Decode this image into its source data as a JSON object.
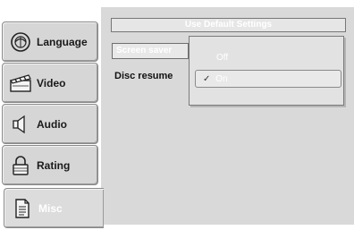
{
  "sidebar": {
    "items": [
      {
        "label": "Language",
        "icon": "globe-icon"
      },
      {
        "label": "Video",
        "icon": "clapperboard-icon"
      },
      {
        "label": "Audio",
        "icon": "speaker-icon"
      },
      {
        "label": "Rating",
        "icon": "lock-icon"
      },
      {
        "label": "Misc",
        "icon": "document-icon",
        "selected": true
      }
    ]
  },
  "main": {
    "default_settings_label": "Use Default Settings",
    "screen_saver_label": "Screen saver",
    "disc_resume_label": "Disc resume"
  },
  "dropdown": {
    "options": [
      {
        "label": "Off",
        "selected": false
      },
      {
        "label": "On",
        "selected": true
      }
    ],
    "check_mark": "✓"
  }
}
